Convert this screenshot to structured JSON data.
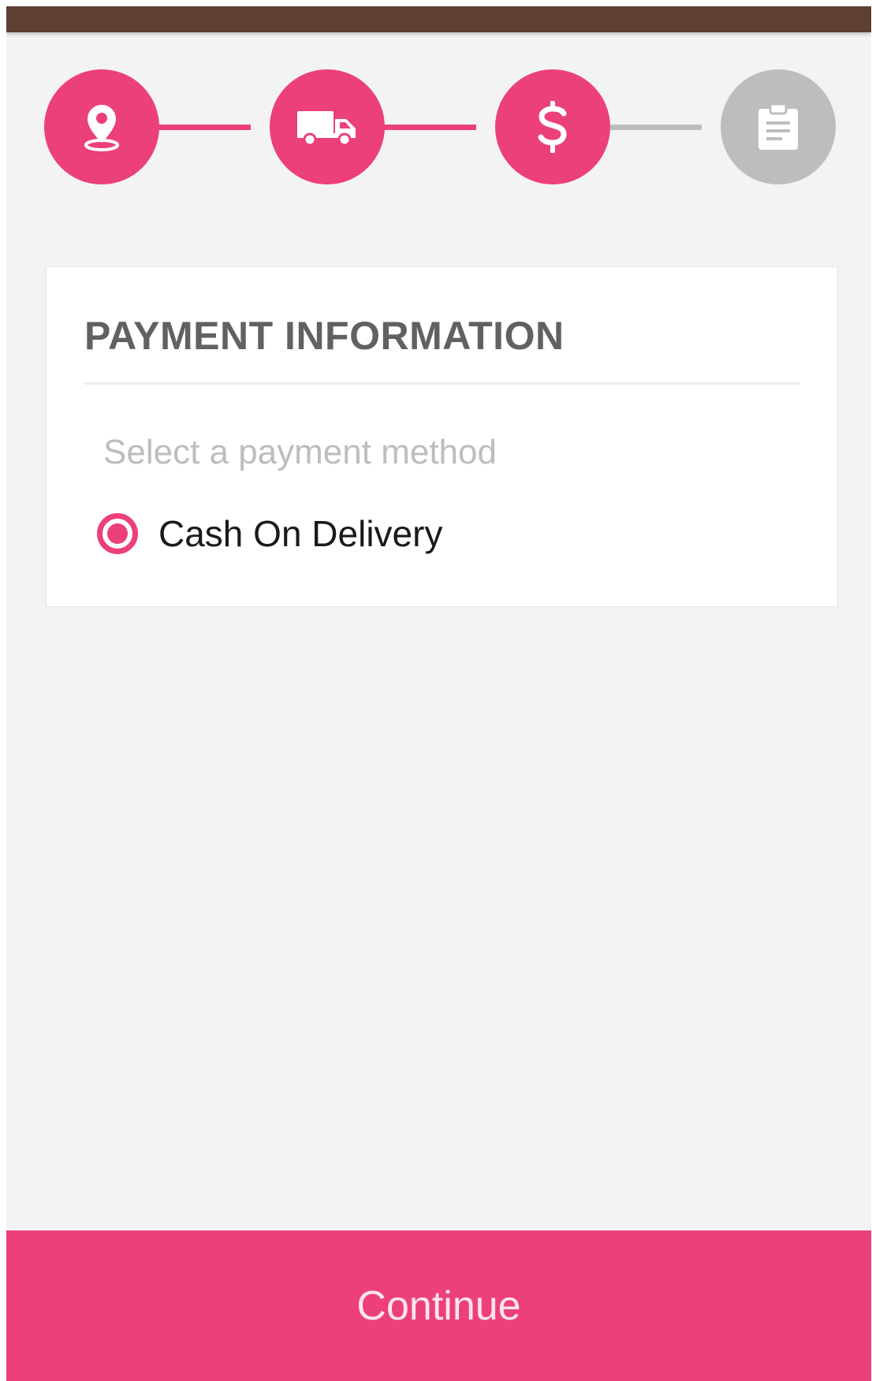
{
  "stepper": {
    "steps": [
      {
        "icon": "location-pin-icon",
        "state": "completed"
      },
      {
        "icon": "truck-icon",
        "state": "completed"
      },
      {
        "icon": "dollar-icon",
        "state": "current"
      },
      {
        "icon": "clipboard-icon",
        "state": "pending"
      }
    ],
    "colors": {
      "active": "#ec407a",
      "inactive": "#bdbdbd"
    }
  },
  "payment": {
    "title": "PAYMENT INFORMATION",
    "hint": "Select a payment method",
    "options": [
      {
        "label": "Cash On Delivery",
        "selected": true
      }
    ]
  },
  "footer": {
    "continue_label": "Continue"
  },
  "theme": {
    "status_bar": "#5d4033",
    "accent": "#ec407a",
    "background": "#f3f3f3"
  }
}
